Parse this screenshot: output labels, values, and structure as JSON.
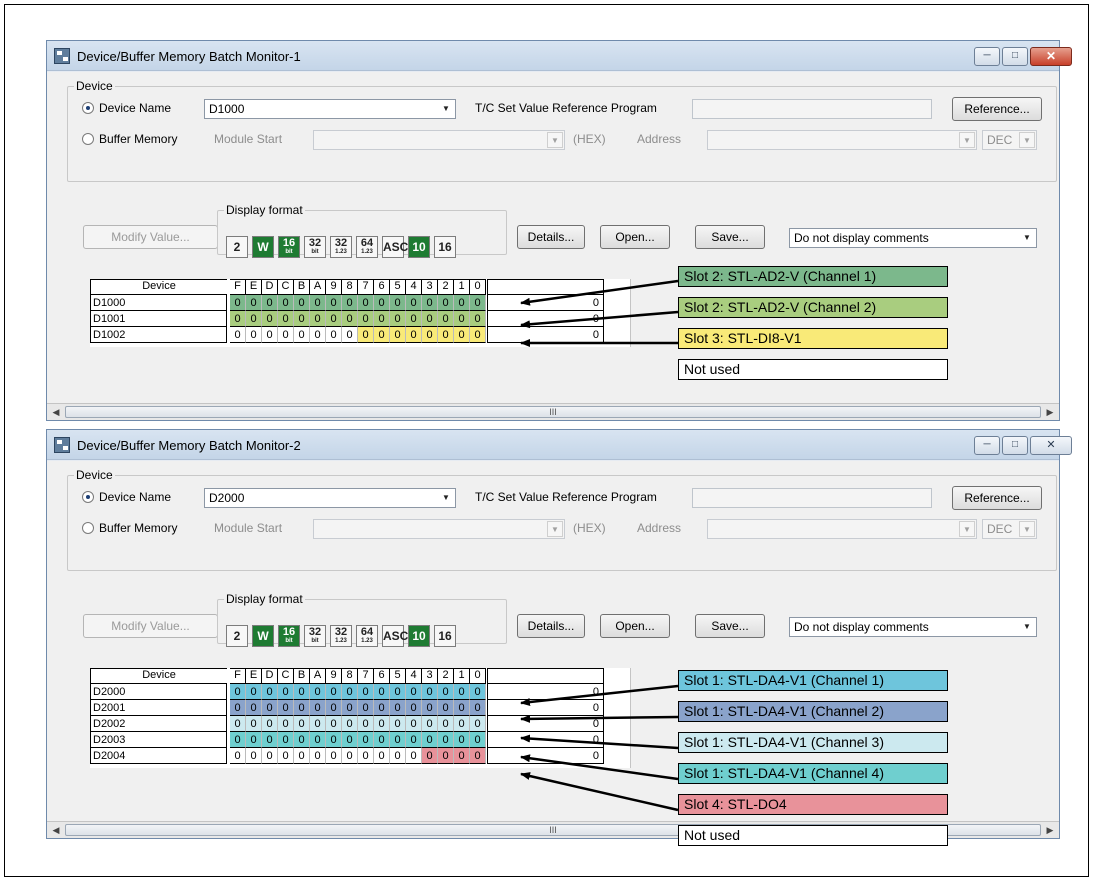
{
  "window1": {
    "title": "Device/Buffer Memory Batch Monitor-1",
    "device_group_label": "Device",
    "device_name_label": "Device Name",
    "device_name_value": "D1000",
    "tc_label": "T/C Set Value Reference Program",
    "reference_label": "Reference...",
    "buffer_memory_label": "Buffer Memory",
    "module_start_label": "Module Start",
    "hex_label": "(HEX)",
    "address_label": "Address",
    "dec_value": "DEC",
    "display_format_label": "Display format",
    "modify_label": "Modify Value...",
    "details_label": "Details...",
    "open_label": "Open...",
    "save_label": "Save...",
    "comments_value": "Do not display comments",
    "scroll_mark": "III",
    "device_header": "Device",
    "bit_headers": [
      "F",
      "E",
      "D",
      "C",
      "B",
      "A",
      "9",
      "8",
      "7",
      "6",
      "5",
      "4",
      "3",
      "2",
      "1",
      "0"
    ],
    "rows": [
      {
        "device": "D1000",
        "bits": "0000000000000000",
        "value": "0",
        "color": "#7cb88c",
        "tint_from": 0
      },
      {
        "device": "D1001",
        "bits": "0000000000000000",
        "value": "0",
        "color": "#a9cd7f",
        "tint_from": 0
      },
      {
        "device": "D1002",
        "bits": "0000000000000000",
        "value": "0",
        "color": "#f9ea78",
        "tint_from": 8
      }
    ]
  },
  "window2": {
    "title": "Device/Buffer Memory Batch Monitor-2",
    "device_group_label": "Device",
    "device_name_label": "Device Name",
    "device_name_value": "D2000",
    "tc_label": "T/C Set Value Reference Program",
    "reference_label": "Reference...",
    "buffer_memory_label": "Buffer Memory",
    "module_start_label": "Module Start",
    "hex_label": "(HEX)",
    "address_label": "Address",
    "dec_value": "DEC",
    "display_format_label": "Display format",
    "modify_label": "Modify Value...",
    "details_label": "Details...",
    "open_label": "Open...",
    "save_label": "Save...",
    "comments_value": "Do not display comments",
    "scroll_mark": "III",
    "device_header": "Device",
    "bit_headers": [
      "F",
      "E",
      "D",
      "C",
      "B",
      "A",
      "9",
      "8",
      "7",
      "6",
      "5",
      "4",
      "3",
      "2",
      "1",
      "0"
    ],
    "rows": [
      {
        "device": "D2000",
        "bits": "0000000000000000",
        "value": "0",
        "color": "#6ec5dc",
        "tint_from": 0
      },
      {
        "device": "D2001",
        "bits": "0000000000000000",
        "value": "0",
        "color": "#8aa3cb",
        "tint_from": 0
      },
      {
        "device": "D2002",
        "bits": "0000000000000000",
        "value": "0",
        "color": "#cce9ef",
        "tint_from": 0
      },
      {
        "device": "D2003",
        "bits": "0000000000000000",
        "value": "0",
        "color": "#6fcfcf",
        "tint_from": 0
      },
      {
        "device": "D2004",
        "bits": "0000000000000000",
        "value": "0",
        "color": "#e8929a",
        "tint_from": 12
      }
    ]
  },
  "format_buttons": [
    {
      "label": "2",
      "sub": "",
      "active": false
    },
    {
      "label": "W",
      "sub": "",
      "active": true
    },
    {
      "label": "16",
      "sub": "bit",
      "active": true
    },
    {
      "label": "32",
      "sub": "bit",
      "active": false
    },
    {
      "label": "32",
      "sub": "1.23",
      "active": false
    },
    {
      "label": "64",
      "sub": "1.23",
      "active": false
    },
    {
      "label": "ASC",
      "sub": "",
      "active": false
    },
    {
      "label": "10",
      "sub": "",
      "active": true
    },
    {
      "label": "16",
      "sub": "",
      "active": false
    }
  ],
  "annotations1": [
    {
      "text": "Slot 2: STL-AD2-V (Channel 1)",
      "color": "#7cb88c"
    },
    {
      "text": "Slot 2: STL-AD2-V (Channel 2)",
      "color": "#a9cd7f"
    },
    {
      "text": "Slot 3: STL-DI8-V1",
      "color": "#f9ea78"
    },
    {
      "text": "Not used",
      "color": "#ffffff"
    }
  ],
  "annotations2": [
    {
      "text": "Slot 1: STL-DA4-V1 (Channel 1)",
      "color": "#6ec5dc"
    },
    {
      "text": "Slot 1: STL-DA4-V1 (Channel 2)",
      "color": "#8aa3cb"
    },
    {
      "text": "Slot 1: STL-DA4-V1 (Channel 3)",
      "color": "#cce9ef"
    },
    {
      "text": "Slot 1: STL-DA4-V1 (Channel 4)",
      "color": "#6fcfcf"
    },
    {
      "text": "Slot 4: STL-DO4",
      "color": "#e8929a"
    },
    {
      "text": "Not used",
      "color": "#ffffff"
    }
  ]
}
